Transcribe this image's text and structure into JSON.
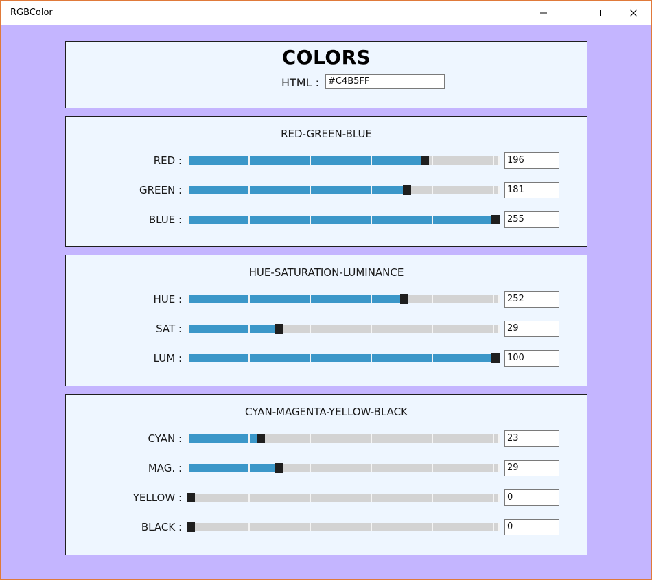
{
  "window": {
    "title": "RGBColor"
  },
  "header": {
    "heading": "COLORS",
    "html_label": "HTML :",
    "html_value": "#C4B5FF"
  },
  "colors": {
    "background": "#c4b5ff",
    "panel": "#eef6ff",
    "fill": "#3b97c9",
    "track": "#d3d3d3",
    "thumb": "#1f1f1f"
  },
  "sections": [
    {
      "title": "RED-GREEN-BLUE",
      "rows": [
        {
          "label": "RED :",
          "value": "196",
          "fraction": 0.7686
        },
        {
          "label": "GREEN :",
          "value": "181",
          "fraction": 0.7098
        },
        {
          "label": "BLUE :",
          "value": "255",
          "fraction": 1.0
        }
      ]
    },
    {
      "title": "HUE-SATURATION-LUMINANCE",
      "rows": [
        {
          "label": "HUE :",
          "value": "252",
          "fraction": 0.7
        },
        {
          "label": "SAT :",
          "value": "29",
          "fraction": 0.29
        },
        {
          "label": "LUM :",
          "value": "100",
          "fraction": 1.0
        }
      ]
    },
    {
      "title": "CYAN-MAGENTA-YELLOW-BLACK",
      "rows": [
        {
          "label": "CYAN :",
          "value": "23",
          "fraction": 0.23
        },
        {
          "label": "MAG. :",
          "value": "29",
          "fraction": 0.29
        },
        {
          "label": "YELLOW :",
          "value": "0",
          "fraction": 0.0
        },
        {
          "label": "BLACK :",
          "value": "0",
          "fraction": 0.0
        }
      ]
    }
  ]
}
